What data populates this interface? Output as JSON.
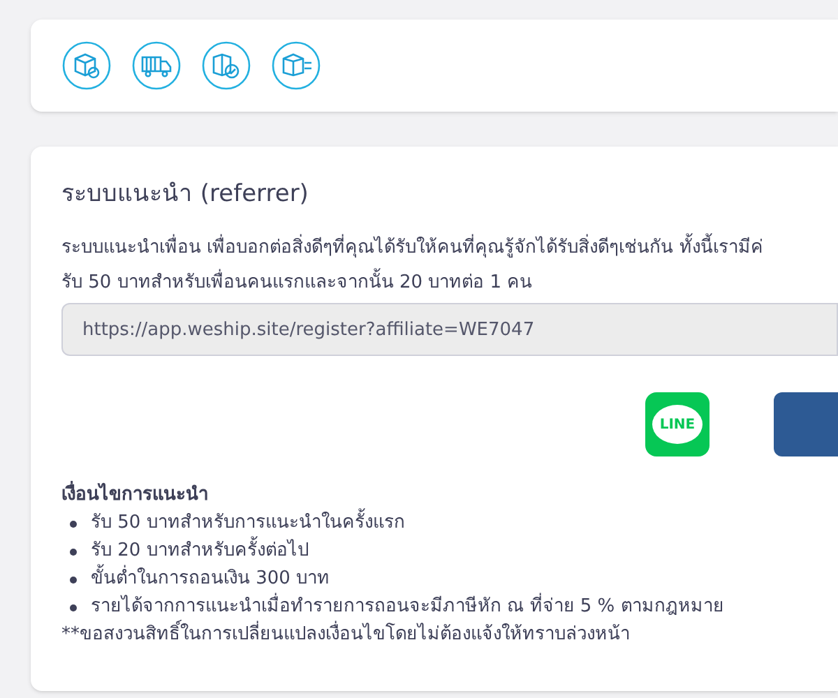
{
  "referrer": {
    "title": "ระบบแนะนำ (referrer)",
    "description": [
      "ระบบแนะนำเพื่อน เพื่อบอกต่อสิ่งดีๆที่คุณได้รับให้คนที่คุณรู้จักได้รับสิ่งดีๆเช่นกัน ทั้งนี้เรามีค่",
      "รับ 50 บาทสำหรับเพื่อนคนแรกและจากนั้น 20 บาทต่อ 1 คน"
    ],
    "link_field": {
      "value": "https://app.weship.site/register?affiliate=WE7047"
    },
    "share_buttons": [
      {
        "kind": "line",
        "label": "LINE"
      },
      {
        "kind": "blue"
      }
    ],
    "conditions": {
      "title": "เงื่อนไขการแนะนำ",
      "items": [
        "รับ 50 บาทสำหรับการแนะนำในครั้งแรก",
        "รับ 20 บาทสำหรับครั้งต่อไป",
        "ขั้นต่ำในการถอนเงิน 300 บาท",
        "รายได้จากการแนะนำเมื่อทำรายการถอนจะมีภาษีหัก ณ ที่จ่าย 5 % ตามกฎหมาย"
      ],
      "note": "**ขอสงวนสิทธิ์ในการเปลี่ยนแปลงเงื่อนไขโดยไม่ต้องแจ้งให้ทราบล่วงหน้า"
    }
  }
}
